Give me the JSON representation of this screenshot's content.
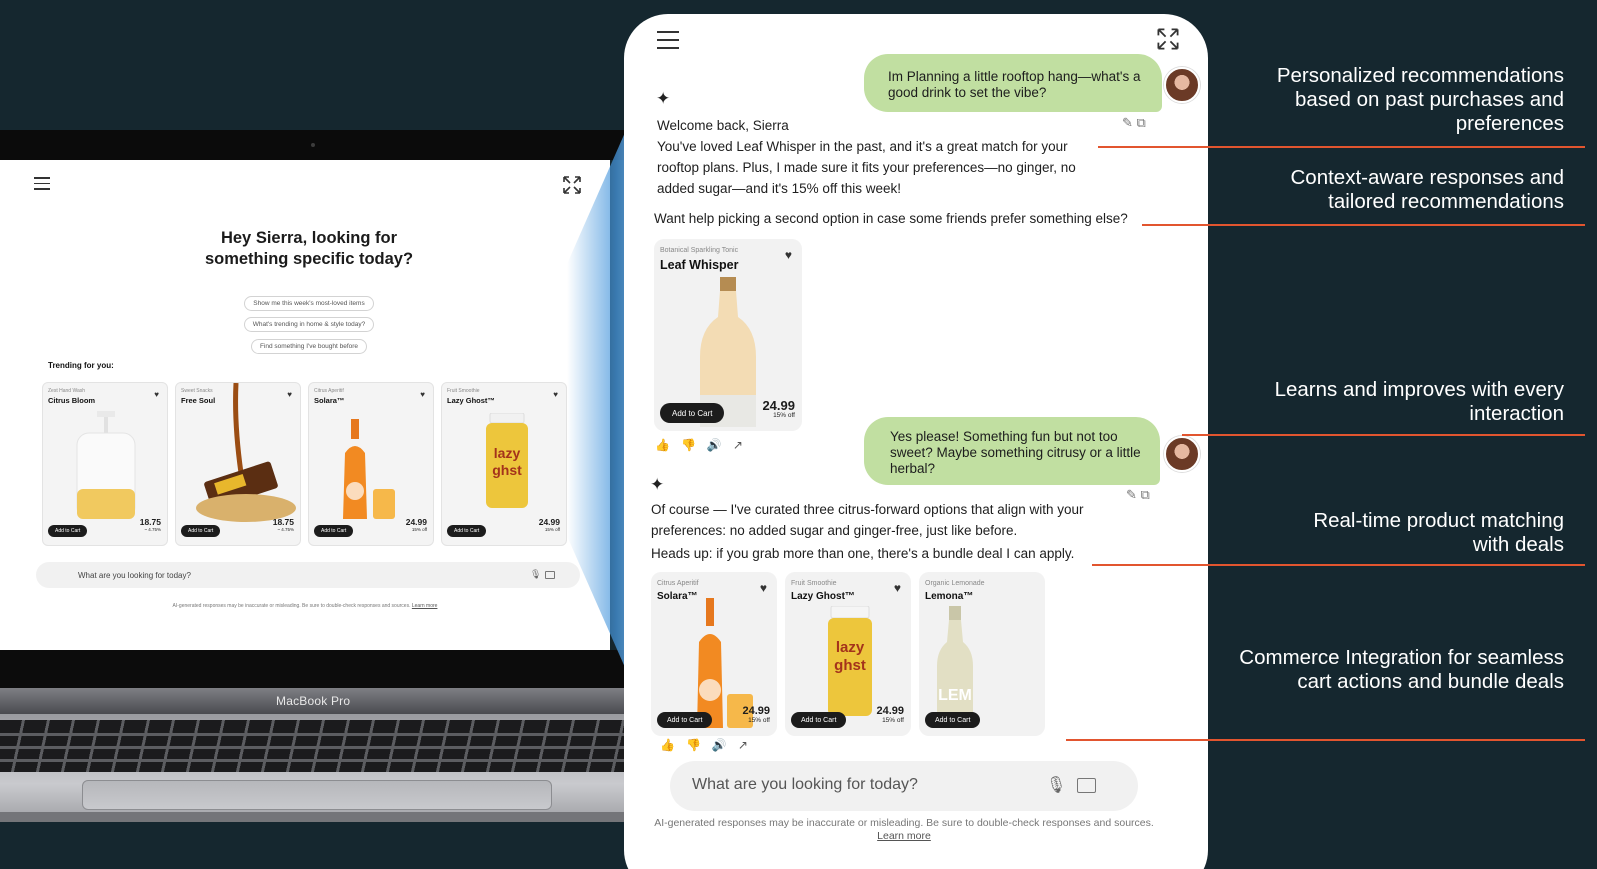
{
  "laptop": {
    "brand": "MacBook Pro",
    "greeting_line1": "Hey Sierra, looking for",
    "greeting_line2": "something specific today?",
    "chips": [
      "Show me this week's most-loved items",
      "What's trending in home & style today?",
      "Find something I've bought before"
    ],
    "trending_label": "Trending for you:",
    "products": [
      {
        "category": "Zest Hand Wash",
        "name": "Citrus Bloom",
        "price": "18.75",
        "discount": "~ 4.75%",
        "button": "Add to Cart"
      },
      {
        "category": "Sweet Snacks",
        "name": "Free Soul",
        "price": "18.75",
        "discount": "~ 4.75%",
        "button": "Add to Cart"
      },
      {
        "category": "Citrus Aperitif",
        "name": "Solara™",
        "price": "24.99",
        "discount": "15% off",
        "button": "Add to Cart"
      },
      {
        "category": "Fruit Smoothie",
        "name": "Lazy Ghost™",
        "price": "24.99",
        "discount": "15% off",
        "button": "Add to Cart"
      }
    ],
    "search_placeholder": "What are you looking for today?",
    "disclaimer": "AI-generated responses may be inaccurate or misleading. Be sure to double-check responses and sources.",
    "learn_more": "Learn more"
  },
  "chat": {
    "user_msg_1": "Im Planning a little rooftop hang—what's a good drink to set the vibe?",
    "ai_welcome": "Welcome back, Sierra",
    "ai_msg_1": "You've loved Leaf Whisper in the past, and it's a great match for your rooftop plans. Plus, I made sure it fits your preferences—no ginger, no added sugar—and it's 15% off this week!",
    "ai_question": "Want help picking a second option in case some friends prefer something else?",
    "product_1": {
      "category": "Botanical Sparkling Tonic",
      "name": "Leaf Whisper",
      "price": "24.99",
      "discount": "15% off",
      "button": "Add to Cart"
    },
    "user_msg_2": "Yes please! Something fun but not too sweet? Maybe something citrusy or a little herbal?",
    "ai_msg_2": "Of course — I've curated three citrus-forward options that align with your preferences: no added sugar and ginger-free, just like before.",
    "ai_msg_3": "Heads up: if you grab more than one, there's a bundle deal I can apply.",
    "products": [
      {
        "category": "Citrus Aperitif",
        "name": "Solara™",
        "price": "24.99",
        "discount": "15% off",
        "button": "Add to Cart"
      },
      {
        "category": "Fruit Smoothie",
        "name": "Lazy Ghost™",
        "price": "24.99",
        "discount": "15% off",
        "button": "Add to Cart"
      },
      {
        "category": "Organic Lemonade",
        "name": "Lemona™",
        "price": "",
        "discount": "",
        "button": "Add to Cart"
      }
    ],
    "search_placeholder": "What are you looking for today?",
    "disclaimer": "AI-generated responses may be inaccurate or misleading. Be sure to double-check responses and sources.",
    "learn_more": "Learn more"
  },
  "callouts": [
    "Personalized recommendations based on past purchases and preferences",
    "Context-aware responses and tailored recommendations",
    "Learns and improves with every interaction",
    "Real-time product matching with deals",
    "Commerce Integration for seamless cart actions and bundle deals"
  ],
  "colors": {
    "background": "#15272f",
    "accent_line": "#e2552f",
    "user_bubble": "#c1dfa1"
  }
}
